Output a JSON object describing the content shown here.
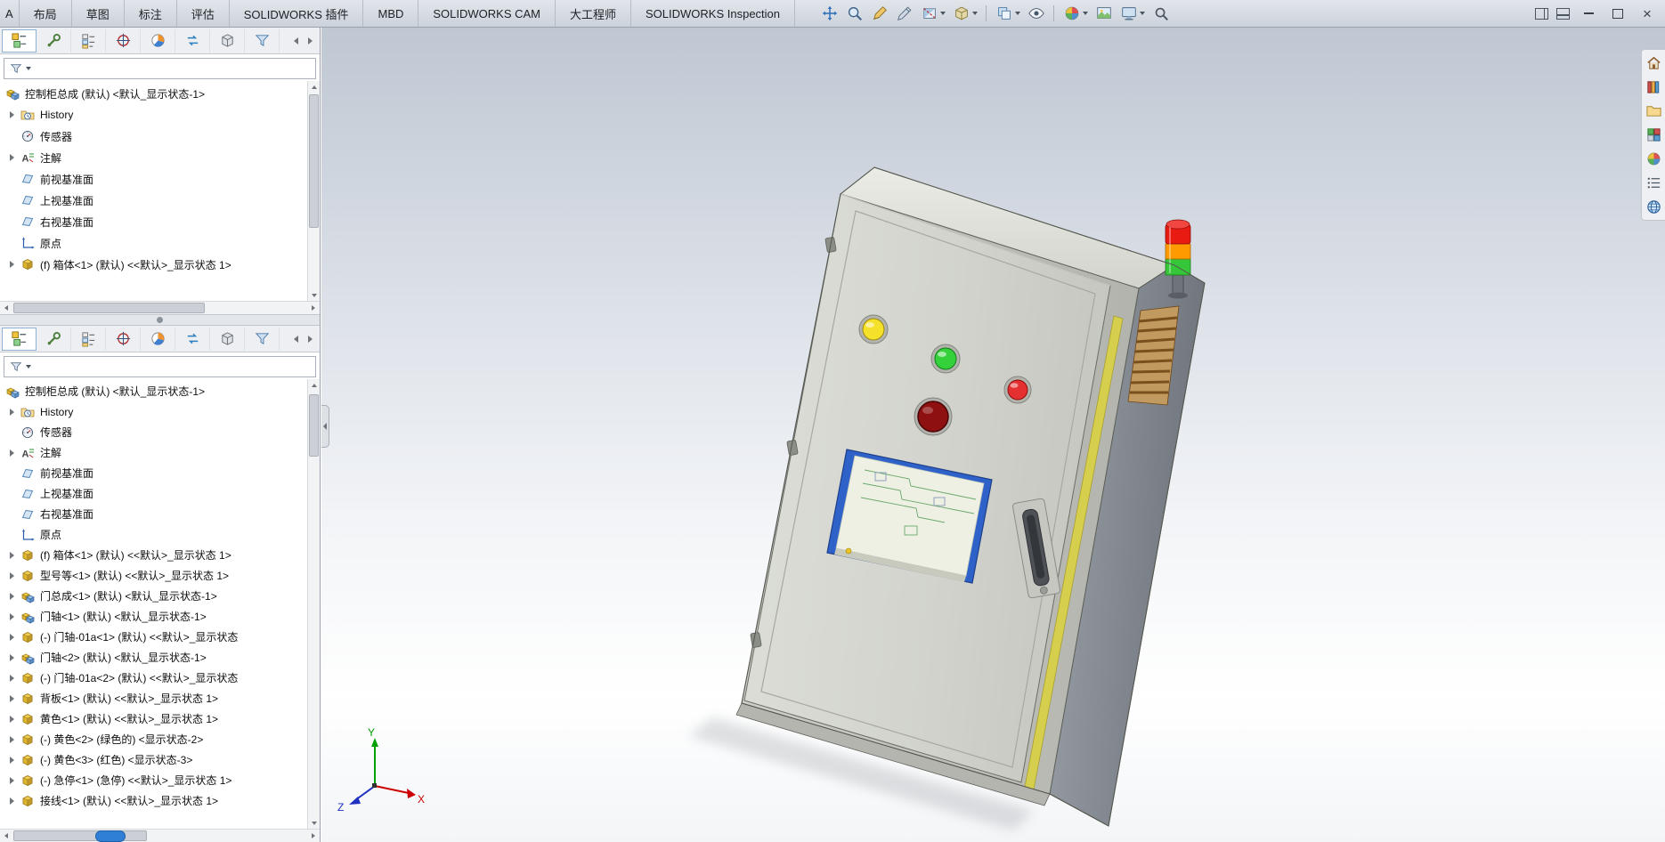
{
  "tabbar": {
    "partial": "A",
    "tabs": [
      "布局",
      "草图",
      "标注",
      "评估",
      "SOLIDWORKS 插件",
      "MBD",
      "SOLIDWORKS CAM",
      "大工程师",
      "SOLIDWORKS Inspection"
    ]
  },
  "quickbar": {
    "icons": [
      {
        "icon": "move-arrows",
        "caret": false
      },
      {
        "icon": "zoom-magnifier",
        "caret": false
      },
      {
        "icon": "sketch-pencil",
        "caret": false
      },
      {
        "icon": "annotation-pencil",
        "caret": false
      },
      {
        "icon": "section-cut",
        "caret": true
      },
      {
        "icon": "component-cube",
        "caret": true,
        "divider": true
      },
      {
        "icon": "copy-sheets",
        "caret": true
      },
      {
        "icon": "visibility-eye",
        "caret": false,
        "divider": true
      },
      {
        "icon": "appearance-sphere",
        "caret": true
      },
      {
        "icon": "scene-image",
        "caret": false
      },
      {
        "icon": "display-monitor",
        "caret": true
      },
      {
        "icon": "search-magnifier",
        "caret": false
      }
    ]
  },
  "paneltabs": {
    "icons": [
      {
        "icon": "feature-tree",
        "active": true
      },
      {
        "icon": "property-wrench"
      },
      {
        "icon": "configuration-list"
      },
      {
        "icon": "dimxpert-target"
      },
      {
        "icon": "display-pie"
      },
      {
        "icon": "swap-arrows"
      },
      {
        "icon": "box-part"
      },
      {
        "icon": "filter-funnel"
      }
    ]
  },
  "panel1": {
    "tree": [
      {
        "icon": "assembly-cubes",
        "label": "控制柜总成 (默认) <默认_显示状态-1>",
        "root": true
      },
      {
        "icon": "history-folder-clock",
        "label": "History",
        "expand": true
      },
      {
        "icon": "sensor-gauge",
        "label": "传感器",
        "expand": false
      },
      {
        "icon": "annotation-a",
        "label": "注解",
        "expand": true
      },
      {
        "icon": "reference-plane",
        "label": "前视基准面",
        "expand": false
      },
      {
        "icon": "reference-plane",
        "label": "上视基准面",
        "expand": false
      },
      {
        "icon": "reference-plane",
        "label": "右视基准面",
        "expand": false
      },
      {
        "icon": "origin-axes",
        "label": "原点",
        "expand": false
      },
      {
        "icon": "part-cube",
        "label": "(f) 箱体<1> (默认) <<默认>_显示状态 1>",
        "expand": true
      }
    ]
  },
  "panel2": {
    "tree": [
      {
        "icon": "assembly-cubes",
        "label": "控制柜总成 (默认) <默认_显示状态-1>",
        "root": true
      },
      {
        "icon": "history-folder-clock",
        "label": "History",
        "expand": true
      },
      {
        "icon": "sensor-gauge",
        "label": "传感器",
        "expand": false
      },
      {
        "icon": "annotation-a",
        "label": "注解",
        "expand": true
      },
      {
        "icon": "reference-plane",
        "label": "前视基准面",
        "expand": false
      },
      {
        "icon": "reference-plane",
        "label": "上视基准面",
        "expand": false
      },
      {
        "icon": "reference-plane",
        "label": "右视基准面",
        "expand": false
      },
      {
        "icon": "origin-axes",
        "label": "原点",
        "expand": false
      },
      {
        "icon": "part-cube",
        "label": "(f) 箱体<1> (默认) <<默认>_显示状态 1>",
        "expand": true
      },
      {
        "icon": "part-cube",
        "label": "型号等<1> (默认) <<默认>_显示状态 1>",
        "expand": true
      },
      {
        "icon": "subassembly-cubes",
        "label": "门总成<1> (默认) <默认_显示状态-1>",
        "expand": true
      },
      {
        "icon": "subassembly-cubes",
        "label": "门轴<1> (默认) <默认_显示状态-1>",
        "expand": true
      },
      {
        "icon": "part-cube",
        "label": "(-) 门轴-01a<1> (默认) <<默认>_显示状态",
        "expand": true
      },
      {
        "icon": "subassembly-cubes",
        "label": "门轴<2> (默认) <默认_显示状态-1>",
        "expand": true
      },
      {
        "icon": "part-cube",
        "label": "(-) 门轴-01a<2> (默认) <<默认>_显示状态",
        "expand": true
      },
      {
        "icon": "part-cube",
        "label": "背板<1> (默认) <<默认>_显示状态 1>",
        "expand": true
      },
      {
        "icon": "part-cube",
        "label": "黄色<1> (默认) <<默认>_显示状态 1>",
        "expand": true
      },
      {
        "icon": "part-cube",
        "label": "(-) 黄色<2> (绿色的) <显示状态-2>",
        "expand": true
      },
      {
        "icon": "part-cube",
        "label": "(-) 黄色<3> (红色) <显示状态-3>",
        "expand": true
      },
      {
        "icon": "part-cube",
        "label": "(-) 急停<1> (急停) <<默认>_显示状态 1>",
        "expand": true
      },
      {
        "icon": "part-cube",
        "label": "接线<1> (默认) <<默认>_显示状态 1>",
        "expand": true
      }
    ]
  },
  "taskpane": {
    "icons": [
      {
        "icon": "home-house"
      },
      {
        "icon": "design-library-books"
      },
      {
        "icon": "file-folder"
      },
      {
        "icon": "view-palette-grid"
      },
      {
        "icon": "appearance-sphere"
      },
      {
        "icon": "properties-list"
      },
      {
        "icon": "globe-world"
      }
    ]
  },
  "viewport": {
    "triad": {
      "x": "X",
      "y": "Y",
      "z": "Z"
    }
  },
  "colors": {
    "btn_yellow": "#f5e02a",
    "btn_green": "#35d13b",
    "btn_red": "#e43030",
    "estop": "#8e1010",
    "tower_red": "#e81b12",
    "tower_orange": "#ff9a00",
    "tower_green": "#36c63a",
    "gasket": "#d6cf4e"
  }
}
